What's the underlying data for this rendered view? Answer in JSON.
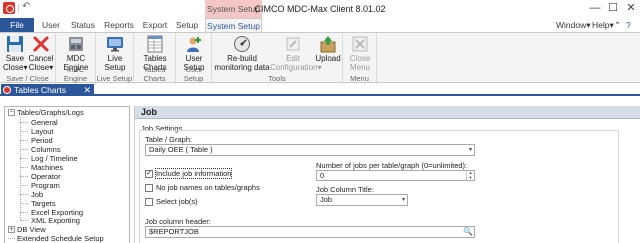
{
  "window": {
    "title": "CIMCO MDC-Max Client 8.01.02",
    "context_tab_group": "System Setup",
    "min_glyph": "—",
    "max_glyph": "☐",
    "close_glyph": "✕",
    "undo_glyph": "↶",
    "dropdown_glyph": "▾"
  },
  "tabs": {
    "file": "File",
    "items": [
      "User",
      "Status",
      "Reports",
      "Export",
      "Setup",
      "System Setup"
    ],
    "active": "System Setup"
  },
  "menu_right": {
    "window": "Window",
    "help": "Help",
    "dropdown": "▾"
  },
  "ribbon": {
    "groups": [
      {
        "label": "Save / Close",
        "buttons": [
          {
            "line1": "Save",
            "line2": "Close",
            "icon": "floppy-disk-icon"
          },
          {
            "line1": "Cancel",
            "line2": "Close",
            "icon": "red-x-icon"
          }
        ]
      },
      {
        "label": "MDC Engine",
        "buttons": [
          {
            "line1": "MDC",
            "line2": "Engine",
            "icon": "engine-icon"
          }
        ]
      },
      {
        "label": "Live Setup",
        "buttons": [
          {
            "line1": "Live",
            "line2": "Setup",
            "icon": "monitor-icon"
          }
        ]
      },
      {
        "label": "Tables Charts",
        "buttons": [
          {
            "line1": "Tables",
            "line2": "Charts",
            "icon": "table-icon"
          }
        ]
      },
      {
        "label": "User Setup",
        "buttons": [
          {
            "line1": "User",
            "line2": "Setup",
            "icon": "add-user-icon"
          }
        ]
      },
      {
        "label": "Tools",
        "buttons": [
          {
            "line1": "Re-build",
            "line2": "monitoring data",
            "icon": "gauge-icon"
          },
          {
            "line1": "Edit",
            "line2": "Configuration",
            "icon": "edit-config-icon",
            "disabled": true
          },
          {
            "line1": "Upload",
            "line2": "",
            "icon": "upload-box-icon"
          }
        ]
      },
      {
        "label": "Menu",
        "buttons": [
          {
            "line1": "Close",
            "line2": "Menu",
            "icon": "close-menu-icon",
            "disabled": true
          }
        ]
      }
    ]
  },
  "doc_tab": {
    "label": "Tables Charts",
    "close": "✕"
  },
  "tree": {
    "root": "Tables/Graphs/Logs",
    "children": [
      "General",
      "Layout",
      "Period",
      "Columns",
      "Log / Timeline",
      "Machines",
      "Operator",
      "Program",
      "Job",
      "Targets",
      "Excel Exporting",
      "XML Exporting"
    ],
    "siblings": [
      "DB View",
      "Extended Schedule Setup"
    ],
    "expanded_glyph": "−",
    "collapsed_glyph": "+"
  },
  "panel": {
    "title": "Job",
    "section_label": "Job Settings",
    "table_graph_label": "Table / Graph:",
    "table_graph_value": "Daily OEE  ( Table )",
    "checkboxes": [
      {
        "label": "Include job information",
        "checked": true
      },
      {
        "label": "No job names on tables/graphs",
        "checked": false
      },
      {
        "label": "Select job(s)",
        "checked": false
      }
    ],
    "check_glyph": "✓",
    "num_jobs_label": "Number of jobs per table/graph (0=unlimited):",
    "num_jobs_value": "0",
    "job_column_title_label": "Job Column Title:",
    "job_column_title_value": "Job",
    "job_column_header_label": "Job column header:",
    "job_column_header_value": "$REPORTJOB"
  },
  "colors": {
    "accent": "#2b579a",
    "context_tab": "#f4c6c6",
    "header_bg": "#d5dde6"
  }
}
